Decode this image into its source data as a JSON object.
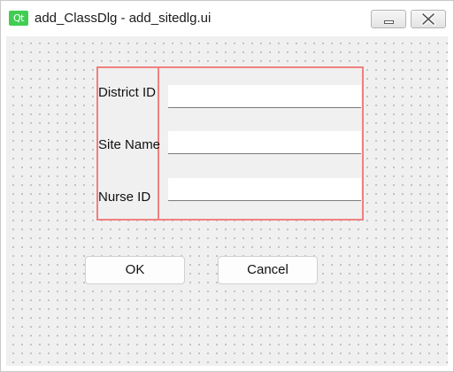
{
  "window": {
    "logo_text": "Qt",
    "title": "add_ClassDlg - add_sitedlg.ui"
  },
  "form": {
    "fields": [
      {
        "label": "District ID",
        "value": ""
      },
      {
        "label": "Site Name",
        "value": ""
      },
      {
        "label": "Nurse ID",
        "value": ""
      }
    ]
  },
  "buttons": {
    "ok_label": "OK",
    "cancel_label": "Cancel"
  },
  "colors": {
    "layout_outline": "#f08080",
    "qt_brand": "#41cd52",
    "canvas_bg": "#f0f0f0"
  },
  "icons": {
    "minimize": "minimize-icon",
    "close": "close-icon"
  }
}
